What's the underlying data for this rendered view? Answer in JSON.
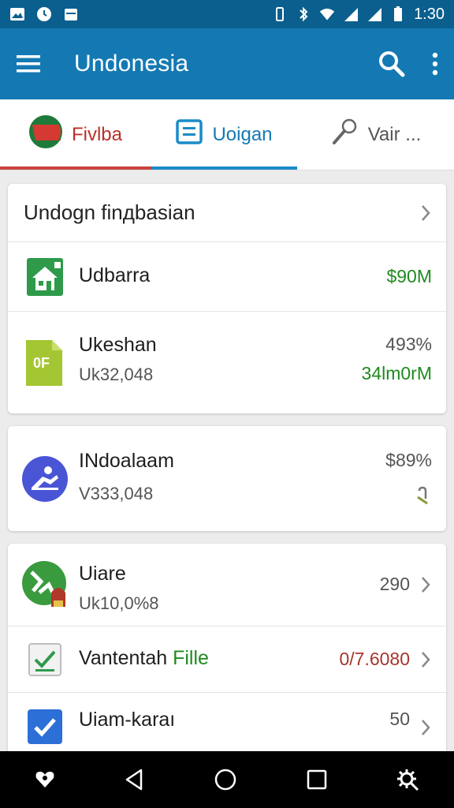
{
  "status_bar": {
    "time": "1:30"
  },
  "app_bar": {
    "title": "Undonesia"
  },
  "tabs": [
    {
      "label": "Fivlba"
    },
    {
      "label": "Uoigan"
    },
    {
      "label": "Vair ..."
    }
  ],
  "card1": {
    "header": "Undogn finдbasian",
    "rows": [
      {
        "title": "Udbarra",
        "value": "$90M"
      },
      {
        "title": "Ukeshan",
        "subtitle": "Uk32,048",
        "value_top": "493%",
        "value_bottom": "34lm0rM",
        "icon_text": "0F"
      }
    ]
  },
  "card2": {
    "rows": [
      {
        "title": "INdoalaam",
        "subtitle": "V333,048",
        "value_top": "$89%"
      }
    ]
  },
  "card3": {
    "rows": [
      {
        "title": "Uiare",
        "subtitle": "Uk10,0%8",
        "value": "290"
      },
      {
        "title": "Vantentah",
        "title_accent": "Fille",
        "value": "0/7.6080"
      },
      {
        "title": "Uiam-karaı",
        "value": "50"
      }
    ]
  },
  "colors": {
    "status_bar": "#0b5f8e",
    "app_bar": "#1479b3",
    "green_value": "#1f8a1f",
    "red_value": "#a8342e",
    "tab_red": "#c8433b",
    "tab_blue": "#1a8bc9"
  }
}
